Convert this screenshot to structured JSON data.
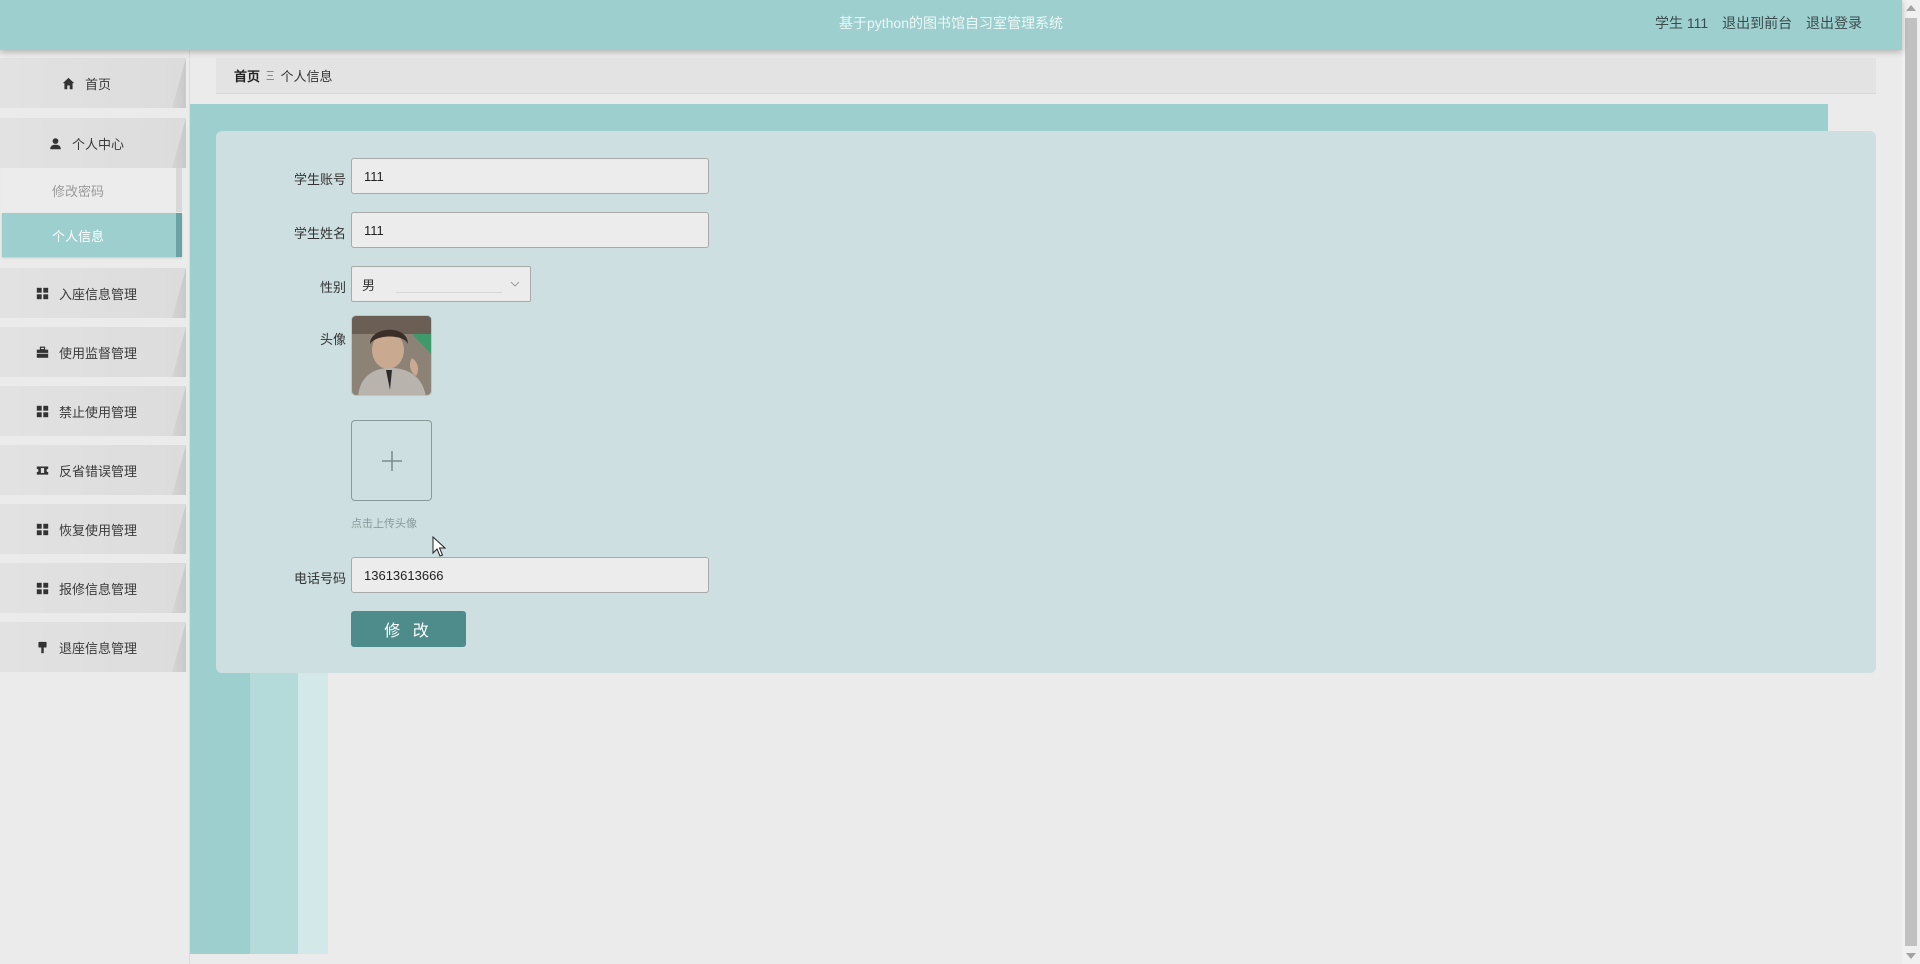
{
  "header": {
    "title": "基于python的图书馆自习室管理系统",
    "user_label": "学生 111",
    "front_link": "退出到前台",
    "logout_link": "退出登录"
  },
  "sidebar": {
    "home": "首页",
    "personal_center": "个人中心",
    "change_password": "修改密码",
    "personal_info": "个人信息",
    "items": [
      {
        "label": "入座信息管理",
        "icon": "grid-icon"
      },
      {
        "label": "使用监督管理",
        "icon": "briefcase-icon"
      },
      {
        "label": "禁止使用管理",
        "icon": "grid-icon"
      },
      {
        "label": "反省错误管理",
        "icon": "ticket-icon"
      },
      {
        "label": "恢复使用管理",
        "icon": "grid-icon"
      },
      {
        "label": "报修信息管理",
        "icon": "grid-icon"
      },
      {
        "label": "退座信息管理",
        "icon": "stamp-icon"
      }
    ]
  },
  "breadcrumb": {
    "home": "首页",
    "separator": "Ξ",
    "current": "个人信息"
  },
  "form": {
    "account_label": "学生账号",
    "account_value": "111",
    "name_label": "学生姓名",
    "name_value": "111",
    "gender_label": "性别",
    "gender_value": "男",
    "avatar_label": "头像",
    "upload_hint": "点击上传头像",
    "phone_label": "电话号码",
    "phone_value": "13613613666",
    "submit_label": "修 改"
  },
  "colors": {
    "accent": "#9ecfcf",
    "panel": "#cddfe0",
    "button": "#4e8c8c"
  }
}
